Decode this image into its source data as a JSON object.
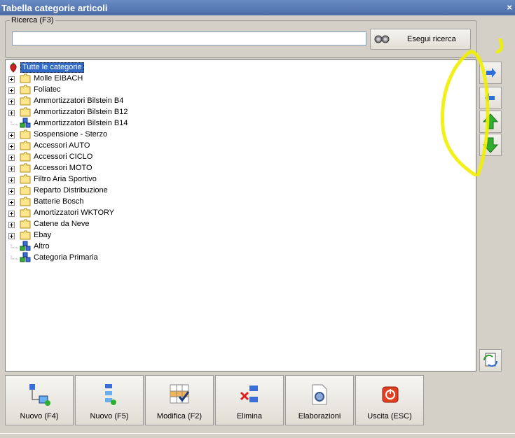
{
  "window": {
    "title": "Tabella categorie articoli",
    "close_glyph": "×"
  },
  "search": {
    "legend": "Ricerca (F3)",
    "value": "",
    "placeholder": "",
    "button_label": "Esegui ricerca",
    "button_icon": "binoculars-icon"
  },
  "tree": {
    "root": {
      "label": "Tutte le categorie",
      "icon": "strawberry-icon"
    },
    "items": [
      {
        "label": "Molle EIBACH",
        "icon": "folder-icon",
        "expandable": true
      },
      {
        "label": "Foliatec",
        "icon": "folder-icon",
        "expandable": true
      },
      {
        "label": "Ammortizzatori Bilstein B4",
        "icon": "folder-icon",
        "expandable": true
      },
      {
        "label": "Ammortizzatori Bilstein B12",
        "icon": "folder-icon",
        "expandable": true
      },
      {
        "label": "Ammortizzatori Bilstein B14",
        "icon": "category-cubes-icon",
        "expandable": false
      },
      {
        "label": "Sospensione - Sterzo",
        "icon": "folder-icon",
        "expandable": true
      },
      {
        "label": "Accessori AUTO",
        "icon": "folder-icon",
        "expandable": true
      },
      {
        "label": "Accessori CICLO",
        "icon": "folder-icon",
        "expandable": true
      },
      {
        "label": "Accessori MOTO",
        "icon": "folder-icon",
        "expandable": true
      },
      {
        "label": "Filtro Aria Sportivo",
        "icon": "folder-icon",
        "expandable": true
      },
      {
        "label": "Reparto Distribuzione",
        "icon": "folder-icon",
        "expandable": true
      },
      {
        "label": "Batterie Bosch",
        "icon": "folder-icon",
        "expandable": true
      },
      {
        "label": "Amortizzatori WKTORY",
        "icon": "folder-icon",
        "expandable": true
      },
      {
        "label": "Catene da Neve",
        "icon": "folder-icon",
        "expandable": true
      },
      {
        "label": "Ebay",
        "icon": "folder-icon",
        "expandable": true
      },
      {
        "label": "Altro",
        "icon": "category-cubes-icon",
        "expandable": false
      },
      {
        "label": "Categoria Primaria",
        "icon": "category-cubes-icon",
        "expandable": false
      }
    ]
  },
  "side_buttons": [
    "arrow-right-icon",
    "arrow-left-icon",
    "arrow-up-icon",
    "arrow-down-icon"
  ],
  "refresh_icon": "refresh-document-icon",
  "actions": [
    {
      "label": "Nuovo (F4)",
      "icon": "new-child-node-icon"
    },
    {
      "label": "Nuovo (F5)",
      "icon": "new-sibling-node-icon"
    },
    {
      "label": "Modifica (F2)",
      "icon": "edit-grid-icon"
    },
    {
      "label": "Elimina",
      "icon": "delete-node-icon"
    },
    {
      "label": "Elaborazioni",
      "icon": "processing-gear-icon"
    },
    {
      "label": "Uscita (ESC)",
      "icon": "exit-power-icon"
    }
  ],
  "colors": {
    "title_bar": "#4a6ba8",
    "selection": "#316ac5",
    "highlight_marker": "#f0f000",
    "arrow_blue": "#2a70d8",
    "arrow_green": "#2fae2f",
    "exit_red": "#e04020"
  }
}
